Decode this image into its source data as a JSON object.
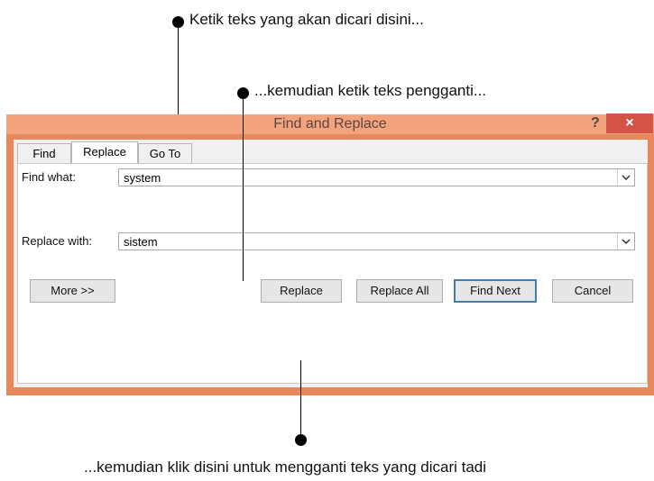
{
  "annotations": {
    "find_hint": "Ketik teks yang akan dicari disini...",
    "replace_hint": "...kemudian ketik teks pengganti...",
    "button_hint": "...kemudian klik disini untuk mengganti teks yang dicari tadi"
  },
  "dialog": {
    "title": "Find and Replace",
    "help_label": "?",
    "close_label": "×",
    "tabs": [
      {
        "label": "Find",
        "active": false
      },
      {
        "label": "Replace",
        "active": true
      },
      {
        "label": "Go To",
        "active": false
      }
    ],
    "find_label": "Find what:",
    "find_value": "system",
    "replace_label": "Replace with:",
    "replace_value": "sistem",
    "buttons": {
      "more": "More >>",
      "replace": "Replace",
      "replace_all": "Replace All",
      "find_next": "Find Next",
      "cancel": "Cancel"
    }
  },
  "colors": {
    "title_bar": "#f3a37e",
    "frame": "#e7875b",
    "close": "#d35346",
    "default_button_border": "#3c7fb1"
  }
}
